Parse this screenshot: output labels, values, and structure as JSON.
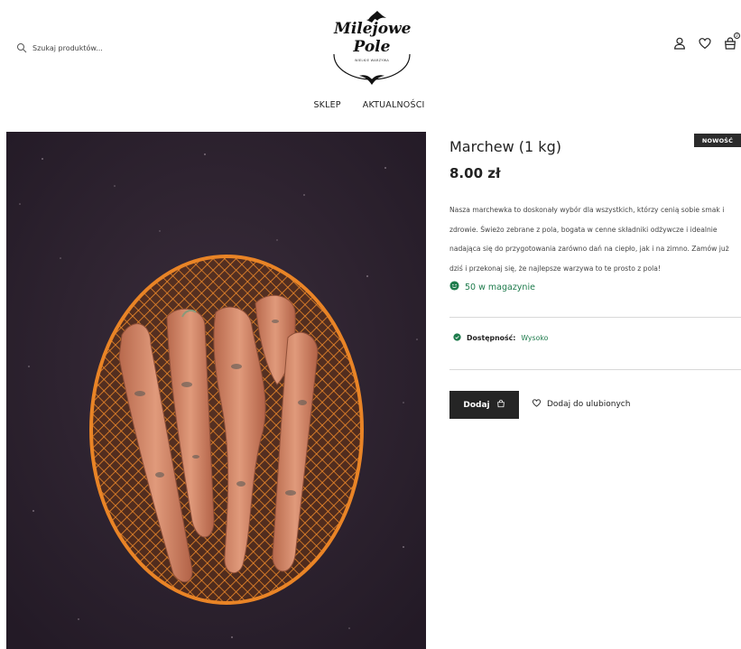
{
  "header": {
    "search": {
      "placeholder": "Szukaj produktów..."
    },
    "logo": {
      "line1": "Milejowe",
      "line2": "Pole",
      "tagline": "WIELKIE WARZYWA"
    },
    "icons": [
      "search-icon",
      "user-icon",
      "heart-icon",
      "cart-icon"
    ],
    "cart_count": "0"
  },
  "nav": {
    "items": [
      {
        "label": "SKLEP"
      },
      {
        "label": "AKTUALNOŚCI"
      }
    ]
  },
  "product": {
    "badge": "NOWOŚĆ",
    "title": "Marchew (1 kg)",
    "price": "8.00 zł",
    "description": "Nasza marchewka to doskonały wybór dla wszystkich, którzy cenią sobie smak i zdrowie. Świeżo zebrane z pola, bogata w cenne składniki odżywcze i idealnie nadająca się do przygotowania zarówno dań na ciepło, jak i na zimno. Zamów już dziś i przekonaj się, że najlepsze warzywa to te prosto z pola!",
    "stock": "50 w magazynie",
    "availability_label": "Dostępność:",
    "availability_value": "Wysoko",
    "add_button": "Dodaj",
    "wishlist": "Dodaj do ulubionych"
  },
  "colors": {
    "accent_green": "#1e7b4c",
    "dark": "#252525",
    "image_background": "#2a1f2c",
    "net": "#e07a22",
    "carrot": "#d98a68"
  }
}
